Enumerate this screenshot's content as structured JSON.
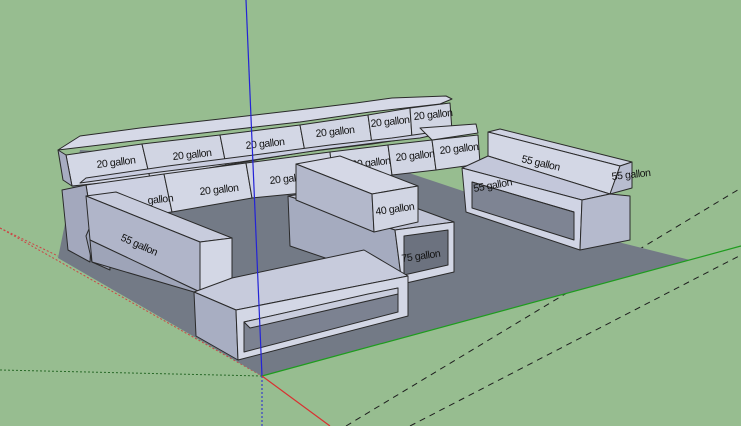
{
  "app": {
    "name": "SketchUp model viewport"
  },
  "colors": {
    "background": "#97bd90",
    "ground_shadow": "#737a86",
    "face_light": "#d3d7e5",
    "face_mid": "#b4b9cd",
    "face_dark": "#9da3b8",
    "edge": "#2a2a2a",
    "axis_red": "#d93030",
    "axis_green": "#1e9c1e",
    "axis_blue": "#2323d6"
  },
  "tank_labels": {
    "top_row": [
      "20 gallon",
      "20 gallon",
      "20 gallon",
      "20 gallon",
      "20 gallon",
      "20 gallon"
    ],
    "mid_row": [
      "gallon",
      "20 gallon",
      "20 gallon",
      "20 gallon",
      "20 gallon",
      "20 gallon"
    ],
    "left_tank": "55 gallon",
    "center_front": "40 gallon",
    "center_low": "75 gallon",
    "right_top": "55 gallon",
    "right_end": "55 gallon",
    "right_front": "55 gallon"
  }
}
